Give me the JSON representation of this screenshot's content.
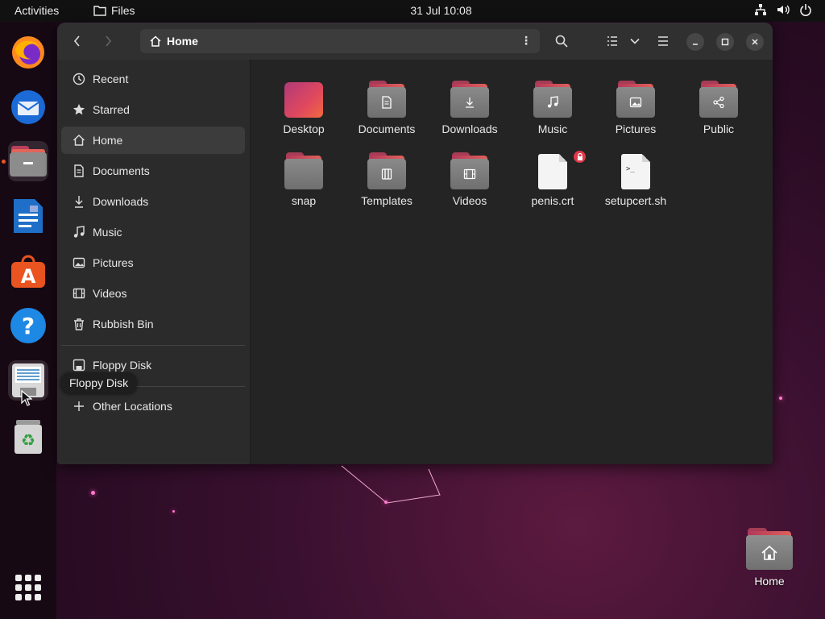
{
  "topbar": {
    "activities": "Activities",
    "app_name": "Files",
    "clock": "31 Jul  10:08"
  },
  "dock": {
    "items": [
      "firefox",
      "thunderbird",
      "files",
      "libreoffice-writer",
      "app-center",
      "help",
      "floppy-disk",
      "rubbish-bin"
    ],
    "show_apps_icon": "grid-icon"
  },
  "window": {
    "path": "Home",
    "sidebar": {
      "items": [
        {
          "label": "Recent",
          "icon": "clock-icon"
        },
        {
          "label": "Starred",
          "icon": "star-icon"
        },
        {
          "label": "Home",
          "icon": "home-icon"
        },
        {
          "label": "Documents",
          "icon": "document-icon"
        },
        {
          "label": "Downloads",
          "icon": "download-icon"
        },
        {
          "label": "Music",
          "icon": "music-icon"
        },
        {
          "label": "Pictures",
          "icon": "picture-icon"
        },
        {
          "label": "Videos",
          "icon": "video-icon"
        },
        {
          "label": "Rubbish Bin",
          "icon": "trash-icon"
        }
      ],
      "devices": [
        {
          "label": "Floppy Disk",
          "icon": "floppy-icon"
        }
      ],
      "other": {
        "label": "Other Locations",
        "icon": "plus-icon"
      }
    },
    "files": [
      {
        "name": "Desktop",
        "kind": "desktop-folder"
      },
      {
        "name": "Documents",
        "kind": "folder",
        "emblem": "document"
      },
      {
        "name": "Downloads",
        "kind": "folder",
        "emblem": "download"
      },
      {
        "name": "Music",
        "kind": "folder",
        "emblem": "music"
      },
      {
        "name": "Pictures",
        "kind": "folder",
        "emblem": "picture"
      },
      {
        "name": "Public",
        "kind": "folder",
        "emblem": "share"
      },
      {
        "name": "snap",
        "kind": "folder",
        "emblem": "none"
      },
      {
        "name": "Templates",
        "kind": "folder",
        "emblem": "template"
      },
      {
        "name": "Videos",
        "kind": "folder",
        "emblem": "video"
      },
      {
        "name": "penis.crt",
        "kind": "file",
        "emblem": "lock"
      },
      {
        "name": "setupcert.sh",
        "kind": "script"
      }
    ]
  },
  "tooltip": "Floppy Disk",
  "desktop": {
    "home_label": "Home"
  },
  "colors": {
    "accent": "#e95420",
    "folder_top": "#c84a62"
  }
}
